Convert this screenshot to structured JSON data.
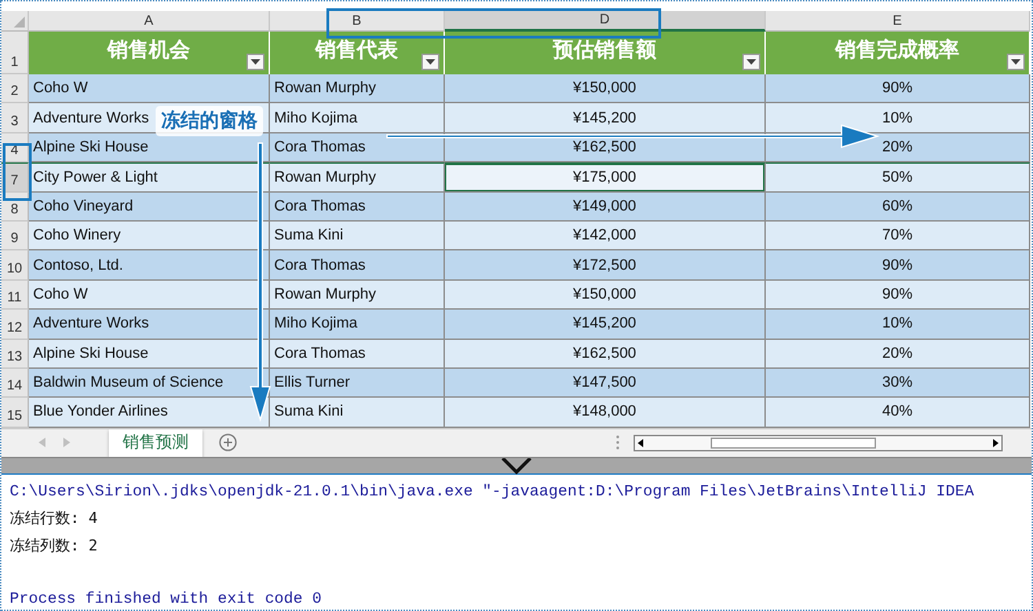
{
  "sheet": {
    "columns": [
      {
        "letter": "A"
      },
      {
        "letter": "B"
      },
      {
        "letter": "D"
      },
      {
        "letter": "E"
      }
    ],
    "header_row": {
      "number": "1",
      "cells": [
        "销售机会",
        "销售代表",
        "预估销售额",
        "销售完成概率"
      ]
    },
    "rows": [
      {
        "number": "2",
        "cells": [
          {
            "text": "Coho W",
            "selected": false
          },
          {
            "text": "Rowan Murphy",
            "selected": false
          },
          {
            "text": "¥150,000",
            "selected": false
          },
          {
            "text": "90%",
            "selected": false
          }
        ]
      },
      {
        "number": "3",
        "cells": [
          {
            "text": "Adventure Works",
            "selected": false
          },
          {
            "text": "Miho Kojima",
            "selected": false
          },
          {
            "text": "¥145,200",
            "selected": false
          },
          {
            "text": "10%",
            "selected": false
          }
        ]
      },
      {
        "number": "4",
        "cells": [
          {
            "text": "Alpine Ski House",
            "selected": false
          },
          {
            "text": "Cora Thomas",
            "selected": false
          },
          {
            "text": "¥162,500",
            "selected": false
          },
          {
            "text": "20%",
            "selected": false
          }
        ]
      },
      {
        "number": "7",
        "cells": [
          {
            "text": "City Power & Light",
            "selected": false
          },
          {
            "text": "Rowan Murphy",
            "selected": false
          },
          {
            "text": "¥175,000",
            "selected": true
          },
          {
            "text": "50%",
            "selected": false
          }
        ]
      },
      {
        "number": "8",
        "cells": [
          {
            "text": "Coho Vineyard",
            "selected": false
          },
          {
            "text": "Cora Thomas",
            "selected": false
          },
          {
            "text": "¥149,000",
            "selected": false
          },
          {
            "text": "60%",
            "selected": false
          }
        ]
      },
      {
        "number": "9",
        "cells": [
          {
            "text": "Coho Winery",
            "selected": false
          },
          {
            "text": "Suma Kini",
            "selected": false
          },
          {
            "text": "¥142,000",
            "selected": false
          },
          {
            "text": "70%",
            "selected": false
          }
        ]
      },
      {
        "number": "10",
        "cells": [
          {
            "text": "Contoso, Ltd.",
            "selected": false
          },
          {
            "text": "Cora Thomas",
            "selected": false
          },
          {
            "text": "¥172,500",
            "selected": false
          },
          {
            "text": "90%",
            "selected": false
          }
        ]
      },
      {
        "number": "11",
        "cells": [
          {
            "text": "Coho W",
            "selected": false
          },
          {
            "text": "Rowan Murphy",
            "selected": false
          },
          {
            "text": "¥150,000",
            "selected": false
          },
          {
            "text": "90%",
            "selected": false
          }
        ]
      },
      {
        "number": "12",
        "cells": [
          {
            "text": "Adventure Works",
            "selected": false
          },
          {
            "text": "Miho Kojima",
            "selected": false
          },
          {
            "text": "¥145,200",
            "selected": false
          },
          {
            "text": "10%",
            "selected": false
          }
        ]
      },
      {
        "number": "13",
        "cells": [
          {
            "text": "Alpine Ski House",
            "selected": false
          },
          {
            "text": "Cora Thomas",
            "selected": false
          },
          {
            "text": "¥162,500",
            "selected": false
          },
          {
            "text": "20%",
            "selected": false
          }
        ]
      },
      {
        "number": "14",
        "cells": [
          {
            "text": "Baldwin Museum of Science",
            "selected": false
          },
          {
            "text": "Ellis Turner",
            "selected": false
          },
          {
            "text": "¥147,500",
            "selected": false
          },
          {
            "text": "30%",
            "selected": false
          }
        ]
      },
      {
        "number": "15",
        "cells": [
          {
            "text": "Blue Yonder Airlines",
            "selected": false
          },
          {
            "text": "Suma Kini",
            "selected": false
          },
          {
            "text": "¥148,000",
            "selected": false
          },
          {
            "text": "40%",
            "selected": false
          }
        ]
      }
    ],
    "annotation": {
      "label": "冻结的窗格"
    },
    "sheet_tabs": [
      {
        "label": "销售预测",
        "selected": true
      }
    ]
  },
  "console": {
    "lines": [
      {
        "kind": "command",
        "text": "C:\\Users\\Sirion\\.jdks\\openjdk-21.0.1\\bin\\java.exe \"-javaagent:D:\\Program Files\\JetBrains\\IntelliJ IDEA"
      },
      {
        "kind": "output",
        "text": "冻结行数: 4"
      },
      {
        "kind": "output",
        "text": "冻结列数: 2"
      },
      {
        "kind": "blank"
      },
      {
        "kind": "status",
        "text": "Process finished with exit code 0"
      }
    ]
  }
}
